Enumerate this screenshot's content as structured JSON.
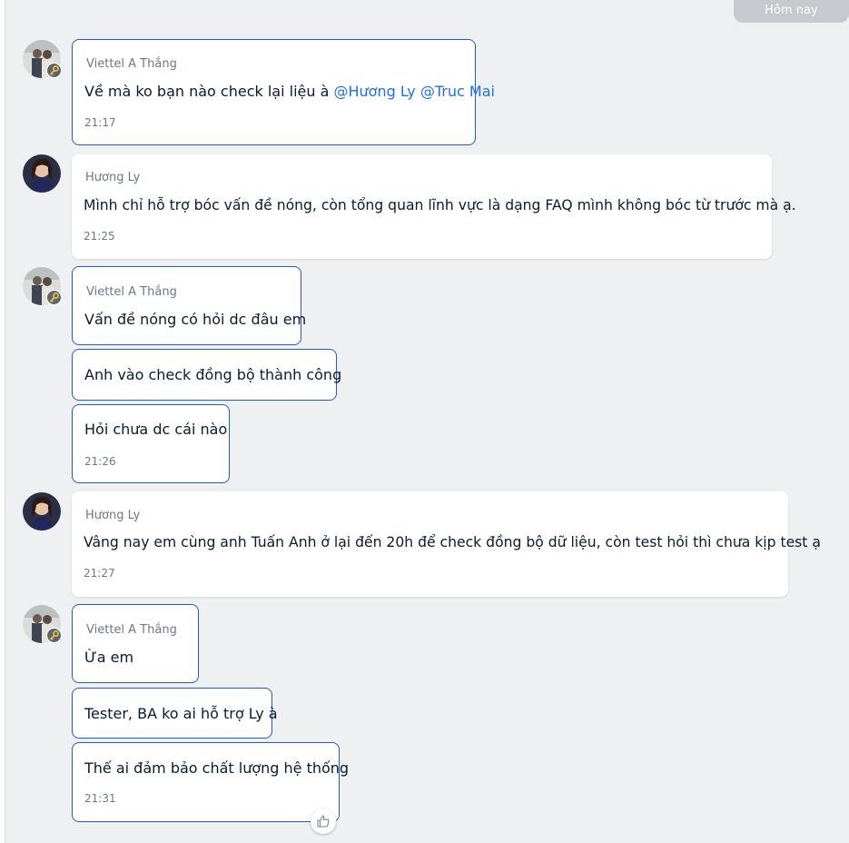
{
  "date_divider": "Hôm nay",
  "messages": [
    {
      "sender": "Viettel A Thắng",
      "text": "Về mà ko bạn nào check lại liệu à ",
      "mention_1": "@Hương Ly",
      "mention_2": "@Truc Mai",
      "time": "21:17"
    },
    {
      "sender": "Hương Ly",
      "text": "Mình chỉ hỗ trợ bóc vấn đề nóng, còn tổng quan lĩnh vực là dạng FAQ mình không bóc từ trước mà ạ.",
      "time": "21:25"
    },
    {
      "sender": "Viettel A Thắng",
      "text_1": "Vấn đề nóng có hỏi dc đâu em",
      "text_2": "Anh vào check đồng bộ thành công",
      "text_3": "Hỏi chưa dc cái nào",
      "time": "21:26"
    },
    {
      "sender": "Hương Ly",
      "text": "Vâng nay em cùng anh Tuấn Anh ở lại đến 20h để check đồng bộ dữ liệu, còn test hỏi thì chưa kịp test ạ",
      "time": "21:27"
    },
    {
      "sender": "Viettel A Thắng",
      "text_1": "Ừa em",
      "text_2": "Tester, BA ko ai hỗ trợ Ly à",
      "text_3": "Thế ai đảm bảo chất lượng hệ thống",
      "time": "21:31"
    }
  ],
  "icons": {
    "key_badge": "key-icon",
    "reaction": "thumbs-up-icon"
  },
  "colors": {
    "own_border": "#1d5bd8",
    "mention": "#1d6ff0",
    "background": "#eef0f1"
  }
}
